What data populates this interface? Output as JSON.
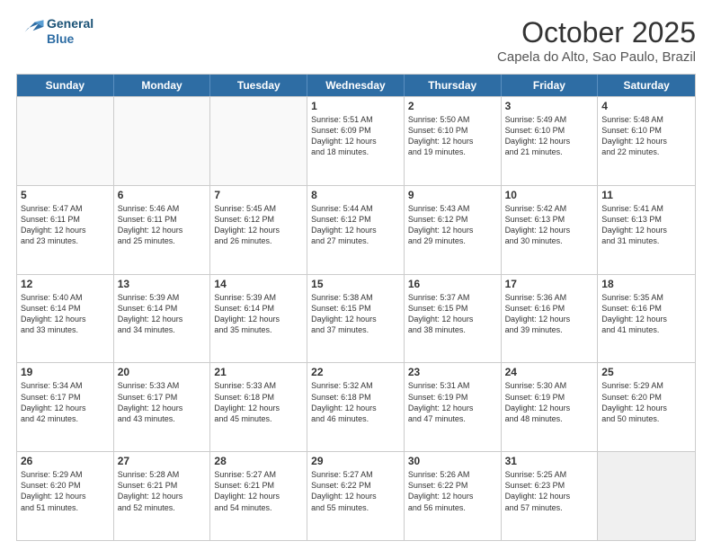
{
  "logo": {
    "line1": "General",
    "line2": "Blue"
  },
  "title": "October 2025",
  "subtitle": "Capela do Alto, Sao Paulo, Brazil",
  "days": [
    "Sunday",
    "Monday",
    "Tuesday",
    "Wednesday",
    "Thursday",
    "Friday",
    "Saturday"
  ],
  "weeks": [
    [
      {
        "num": "",
        "text": "",
        "empty": true
      },
      {
        "num": "",
        "text": "",
        "empty": true
      },
      {
        "num": "",
        "text": "",
        "empty": true
      },
      {
        "num": "1",
        "text": "Sunrise: 5:51 AM\nSunset: 6:09 PM\nDaylight: 12 hours\nand 18 minutes."
      },
      {
        "num": "2",
        "text": "Sunrise: 5:50 AM\nSunset: 6:10 PM\nDaylight: 12 hours\nand 19 minutes."
      },
      {
        "num": "3",
        "text": "Sunrise: 5:49 AM\nSunset: 6:10 PM\nDaylight: 12 hours\nand 21 minutes."
      },
      {
        "num": "4",
        "text": "Sunrise: 5:48 AM\nSunset: 6:10 PM\nDaylight: 12 hours\nand 22 minutes."
      }
    ],
    [
      {
        "num": "5",
        "text": "Sunrise: 5:47 AM\nSunset: 6:11 PM\nDaylight: 12 hours\nand 23 minutes."
      },
      {
        "num": "6",
        "text": "Sunrise: 5:46 AM\nSunset: 6:11 PM\nDaylight: 12 hours\nand 25 minutes."
      },
      {
        "num": "7",
        "text": "Sunrise: 5:45 AM\nSunset: 6:12 PM\nDaylight: 12 hours\nand 26 minutes."
      },
      {
        "num": "8",
        "text": "Sunrise: 5:44 AM\nSunset: 6:12 PM\nDaylight: 12 hours\nand 27 minutes."
      },
      {
        "num": "9",
        "text": "Sunrise: 5:43 AM\nSunset: 6:12 PM\nDaylight: 12 hours\nand 29 minutes."
      },
      {
        "num": "10",
        "text": "Sunrise: 5:42 AM\nSunset: 6:13 PM\nDaylight: 12 hours\nand 30 minutes."
      },
      {
        "num": "11",
        "text": "Sunrise: 5:41 AM\nSunset: 6:13 PM\nDaylight: 12 hours\nand 31 minutes."
      }
    ],
    [
      {
        "num": "12",
        "text": "Sunrise: 5:40 AM\nSunset: 6:14 PM\nDaylight: 12 hours\nand 33 minutes."
      },
      {
        "num": "13",
        "text": "Sunrise: 5:39 AM\nSunset: 6:14 PM\nDaylight: 12 hours\nand 34 minutes."
      },
      {
        "num": "14",
        "text": "Sunrise: 5:39 AM\nSunset: 6:14 PM\nDaylight: 12 hours\nand 35 minutes."
      },
      {
        "num": "15",
        "text": "Sunrise: 5:38 AM\nSunset: 6:15 PM\nDaylight: 12 hours\nand 37 minutes."
      },
      {
        "num": "16",
        "text": "Sunrise: 5:37 AM\nSunset: 6:15 PM\nDaylight: 12 hours\nand 38 minutes."
      },
      {
        "num": "17",
        "text": "Sunrise: 5:36 AM\nSunset: 6:16 PM\nDaylight: 12 hours\nand 39 minutes."
      },
      {
        "num": "18",
        "text": "Sunrise: 5:35 AM\nSunset: 6:16 PM\nDaylight: 12 hours\nand 41 minutes."
      }
    ],
    [
      {
        "num": "19",
        "text": "Sunrise: 5:34 AM\nSunset: 6:17 PM\nDaylight: 12 hours\nand 42 minutes."
      },
      {
        "num": "20",
        "text": "Sunrise: 5:33 AM\nSunset: 6:17 PM\nDaylight: 12 hours\nand 43 minutes."
      },
      {
        "num": "21",
        "text": "Sunrise: 5:33 AM\nSunset: 6:18 PM\nDaylight: 12 hours\nand 45 minutes."
      },
      {
        "num": "22",
        "text": "Sunrise: 5:32 AM\nSunset: 6:18 PM\nDaylight: 12 hours\nand 46 minutes."
      },
      {
        "num": "23",
        "text": "Sunrise: 5:31 AM\nSunset: 6:19 PM\nDaylight: 12 hours\nand 47 minutes."
      },
      {
        "num": "24",
        "text": "Sunrise: 5:30 AM\nSunset: 6:19 PM\nDaylight: 12 hours\nand 48 minutes."
      },
      {
        "num": "25",
        "text": "Sunrise: 5:29 AM\nSunset: 6:20 PM\nDaylight: 12 hours\nand 50 minutes."
      }
    ],
    [
      {
        "num": "26",
        "text": "Sunrise: 5:29 AM\nSunset: 6:20 PM\nDaylight: 12 hours\nand 51 minutes."
      },
      {
        "num": "27",
        "text": "Sunrise: 5:28 AM\nSunset: 6:21 PM\nDaylight: 12 hours\nand 52 minutes."
      },
      {
        "num": "28",
        "text": "Sunrise: 5:27 AM\nSunset: 6:21 PM\nDaylight: 12 hours\nand 54 minutes."
      },
      {
        "num": "29",
        "text": "Sunrise: 5:27 AM\nSunset: 6:22 PM\nDaylight: 12 hours\nand 55 minutes."
      },
      {
        "num": "30",
        "text": "Sunrise: 5:26 AM\nSunset: 6:22 PM\nDaylight: 12 hours\nand 56 minutes."
      },
      {
        "num": "31",
        "text": "Sunrise: 5:25 AM\nSunset: 6:23 PM\nDaylight: 12 hours\nand 57 minutes."
      },
      {
        "num": "",
        "text": "",
        "empty": true,
        "shaded": true
      }
    ]
  ]
}
